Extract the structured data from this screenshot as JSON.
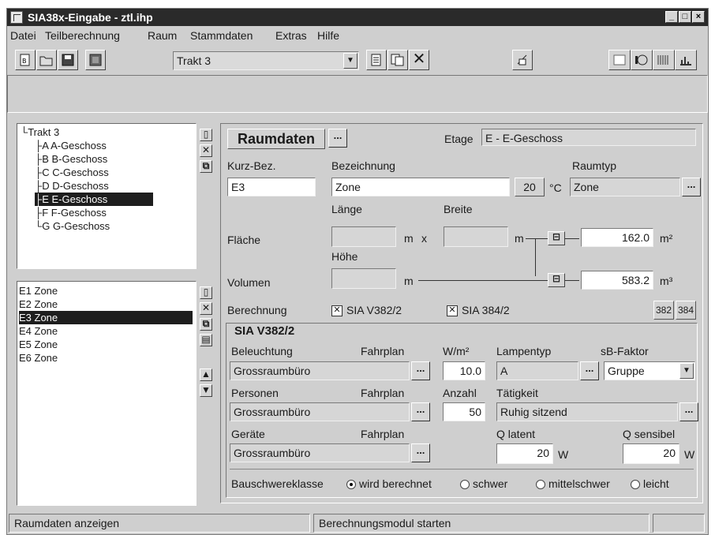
{
  "window": {
    "title": "SIA38x-Eingabe - ztl.ihp"
  },
  "menu": [
    "Datei",
    "Teilberechnung",
    "Raum",
    "Stammdaten",
    "Extras",
    "Hilfe"
  ],
  "toolbar": {
    "trakt_select": "Trakt 3"
  },
  "tree": {
    "root": "Trakt 3",
    "items": [
      "A A-Geschoss",
      "B B-Geschoss",
      "C C-Geschoss",
      "D D-Geschoss",
      "E E-Geschoss",
      "F F-Geschoss",
      "G G-Geschoss"
    ],
    "selected_index": 4
  },
  "zones": {
    "items": [
      "E1 Zone",
      "E2 Zone",
      "E3 Zone",
      "E4 Zone",
      "E5 Zone",
      "E6 Zone"
    ],
    "selected_index": 2
  },
  "raumdaten": {
    "heading": "Raumdaten",
    "ellipsis": "...",
    "etage_label": "Etage",
    "etage_value": "E - E-Geschoss",
    "kurz_label": "Kurz-Bez.",
    "kurz_value": "E3",
    "bez_label": "Bezeichnung",
    "bez_value": "Zone",
    "temp_value": "20",
    "temp_unit": "°C",
    "raumtyp_label": "Raumtyp",
    "raumtyp_value": "Zone",
    "laenge_label": "Länge",
    "breite_label": "Breite",
    "hoehe_label": "Höhe",
    "flaeche_label": "Fläche",
    "volumen_label": "Volumen",
    "unit_m": "m",
    "times": "x",
    "flaeche_value": "162.0",
    "flaeche_unit": "m²",
    "volumen_value": "583.2",
    "volumen_unit": "m³",
    "berechnung_label": "Berechnung",
    "calc1": "SIA V382/2",
    "calc2": "SIA 384/2",
    "btn382": "382",
    "btn384": "384"
  },
  "sia": {
    "group_title": "SIA V382/2",
    "beleuchtung_label": "Beleuchtung",
    "fahrplan_label": "Fahrplan",
    "wm2_label": "W/m²",
    "lampentyp_label": "Lampentyp",
    "sbfaktor_label": "sB-Faktor",
    "beleuchtung_value": "Grossraumbüro",
    "wm2_value": "10.0",
    "lampentyp_value": "A",
    "sbfaktor_value": "Gruppe",
    "personen_label": "Personen",
    "anzahl_label": "Anzahl",
    "taetigkeit_label": "Tätigkeit",
    "personen_value": "Grossraumbüro",
    "anzahl_value": "50",
    "taetigkeit_value": "Ruhig sitzend",
    "geraete_label": "Geräte",
    "qlatent_label": "Q latent",
    "qsensibel_label": "Q sensibel",
    "geraete_value": "Grossraumbüro",
    "qlatent_value": "20",
    "qsensibel_value": "20",
    "unit_w": "W",
    "bauschwere_label": "Bauschwereklasse",
    "radios": [
      "wird berechnet",
      "schwer",
      "mittelschwer",
      "leicht"
    ]
  },
  "status": {
    "left": "Raumdaten anzeigen",
    "middle": "Berechnungsmodul starten"
  }
}
